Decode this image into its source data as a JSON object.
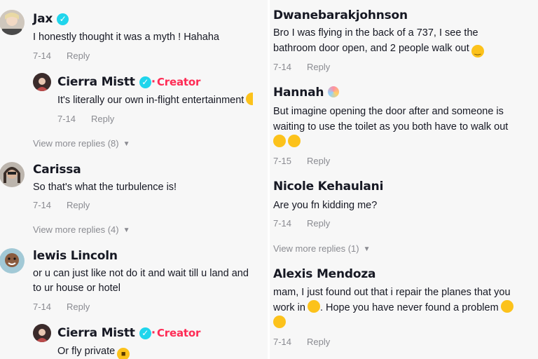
{
  "left": {
    "comments": [
      {
        "username": "Jax",
        "verified": true,
        "text": "I honestly thought it was a myth ! Hahaha",
        "date": "7-14",
        "reply_label": "Reply",
        "replies": [
          {
            "username": "Cierra Mistt",
            "verified": true,
            "badge": "Creator",
            "text": "It's literally our own in-flight entertainment",
            "date": "7-14",
            "reply_label": "Reply"
          }
        ],
        "view_more": "View more replies (8)"
      },
      {
        "username": "Carissa",
        "text": "So that's what the turbulence is!",
        "date": "7-14",
        "reply_label": "Reply",
        "view_more": "View more replies (4)"
      },
      {
        "username": "lewis Lincoln",
        "text_lines": [
          "or u can just like not do it and wait till u land and",
          "to ur house or hotel"
        ],
        "date": "7-14",
        "reply_label": "Reply",
        "replies": [
          {
            "username": "Cierra Mistt",
            "verified": true,
            "badge": "Creator",
            "text": "Or fly private"
          }
        ]
      }
    ]
  },
  "right": {
    "comments": [
      {
        "username": "Dwanebarakjohnson",
        "text_lines": [
          "Bro I was flying in the back of a 737, I see the",
          "bathroom door open, and 2 people walk out"
        ],
        "date": "7-14",
        "reply_label": "Reply"
      },
      {
        "username": "Hannah",
        "text_lines": [
          "But imagine opening the door after and someone is",
          "waiting to use the toilet as you both have to walk out"
        ],
        "date": "7-15",
        "reply_label": "Reply"
      },
      {
        "username": "Nicole Kehaulani",
        "text": "Are you fn kidding me?",
        "date": "7-14",
        "reply_label": "Reply",
        "view_more": "View more replies (1)"
      },
      {
        "username": "Alexis Mendoza",
        "text_lines": [
          "mam, I just found out that i repair the planes that you",
          "work in",
          ". Hope you have never found a problem"
        ],
        "date": "7-14",
        "reply_label": "Reply"
      }
    ]
  },
  "colors": {
    "creator": "#fe2c55",
    "verified": "#20d5ec",
    "meta": "#8a8b91",
    "panel_bg": "#f7f7f7"
  },
  "icons": {
    "verified": "check-badge-icon",
    "chevron": "chevron-down-icon",
    "emoji": "emoji-icon"
  }
}
